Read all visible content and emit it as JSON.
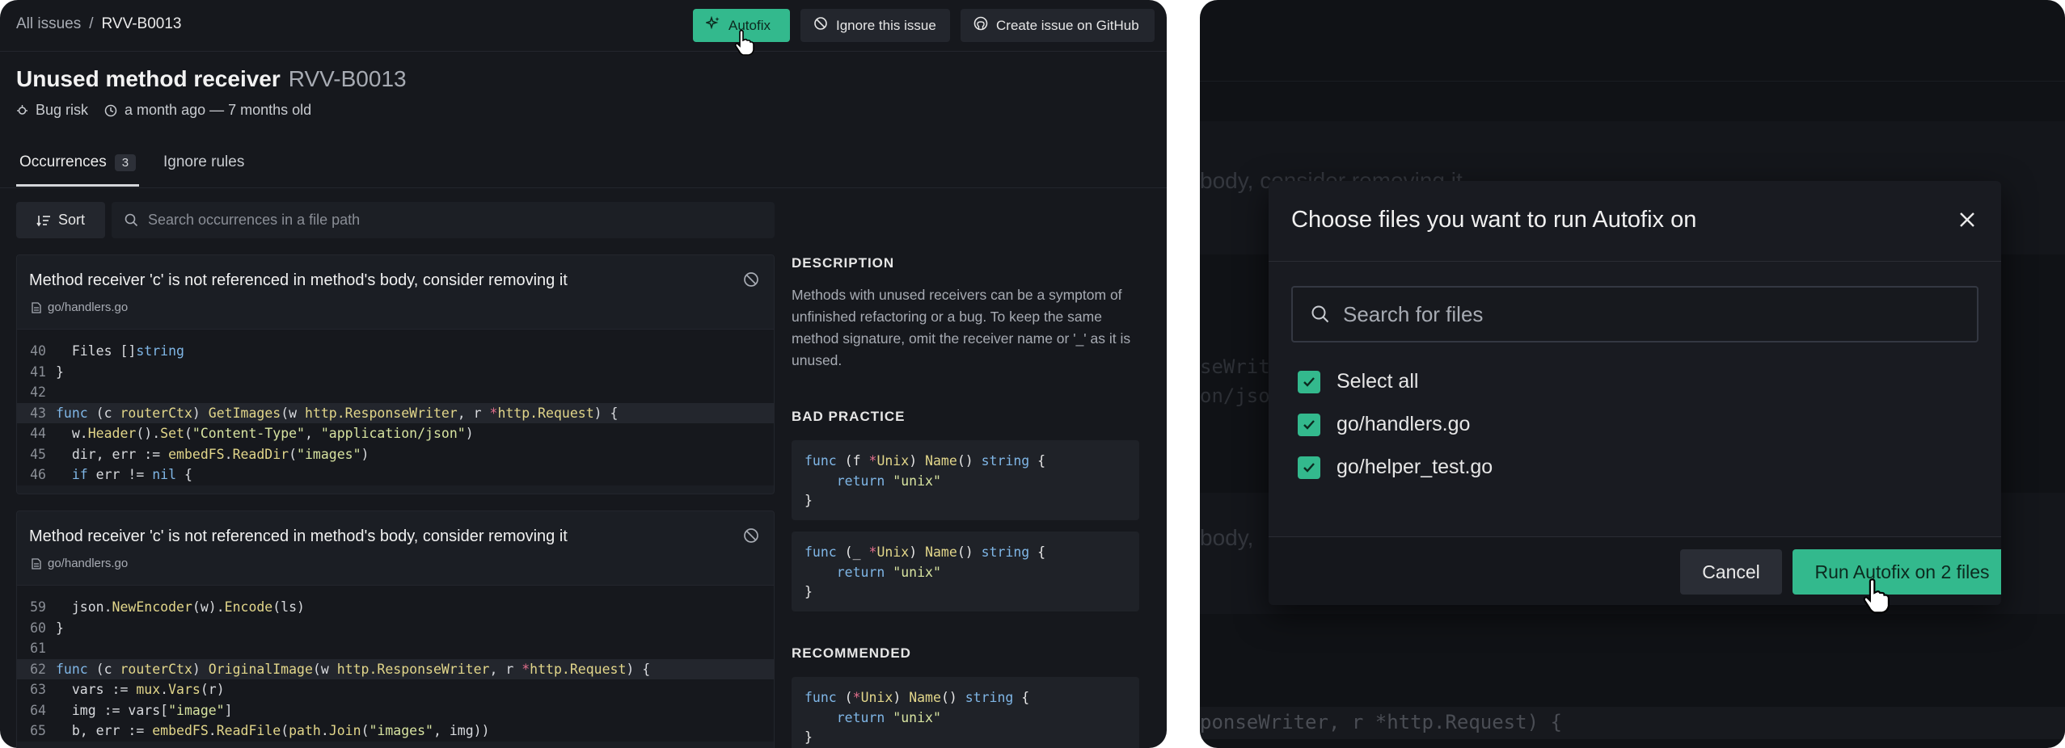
{
  "left": {
    "breadcrumb": {
      "all": "All issues",
      "sep": "/",
      "current": "RVV-B0013"
    },
    "buttons": {
      "autofix": "Autofix",
      "ignore": "Ignore this issue",
      "github": "Create issue on GitHub"
    },
    "issue": {
      "title": "Unused method receiver",
      "code": "RVV-B0013",
      "category": "Bug risk",
      "age": "a month ago — 7 months old"
    },
    "tabs": {
      "occurrences": "Occurrences",
      "occurrences_count": "3",
      "ignore_rules": "Ignore rules"
    },
    "sort_label": "Sort",
    "search_placeholder": "Search occurrences in a file path",
    "occurrences": [
      {
        "title": "Method receiver 'c' is not referenced in method's body, consider removing it",
        "file": "go/handlers.go",
        "lines": [
          "40",
          "41",
          "42",
          "43",
          "44",
          "45",
          "46"
        ]
      },
      {
        "title": "Method receiver 'c' is not referenced in method's body, consider removing it",
        "file": "go/handlers.go",
        "lines": [
          "59",
          "60",
          "61",
          "62",
          "63",
          "64",
          "65"
        ]
      }
    ],
    "side": {
      "description_heading": "DESCRIPTION",
      "description": "Methods with unused receivers can be a symptom of unfinished refactoring or a bug. To keep the same method signature, omit the receiver name or '_' as it is unused.",
      "bad_heading": "BAD PRACTICE",
      "recommended_heading": "RECOMMENDED"
    }
  },
  "right": {
    "modal_title": "Choose files you want to run Autofix on",
    "search_placeholder": "Search for files",
    "select_all": "Select all",
    "files": [
      "go/handlers.go",
      "go/helper_test.go"
    ],
    "cancel": "Cancel",
    "run": "Run Autofix on 2 files",
    "bg_text": {
      "line1": "body, consider removing it",
      "line2": "seWriter",
      "line3": "on/json",
      "line4": "body,",
      "line5": "ponseWriter, r *http.Request) {"
    }
  },
  "colors": {
    "accent": "#33b98d",
    "panel_bg": "#16181d",
    "pointer_red": "#e36f8c"
  }
}
